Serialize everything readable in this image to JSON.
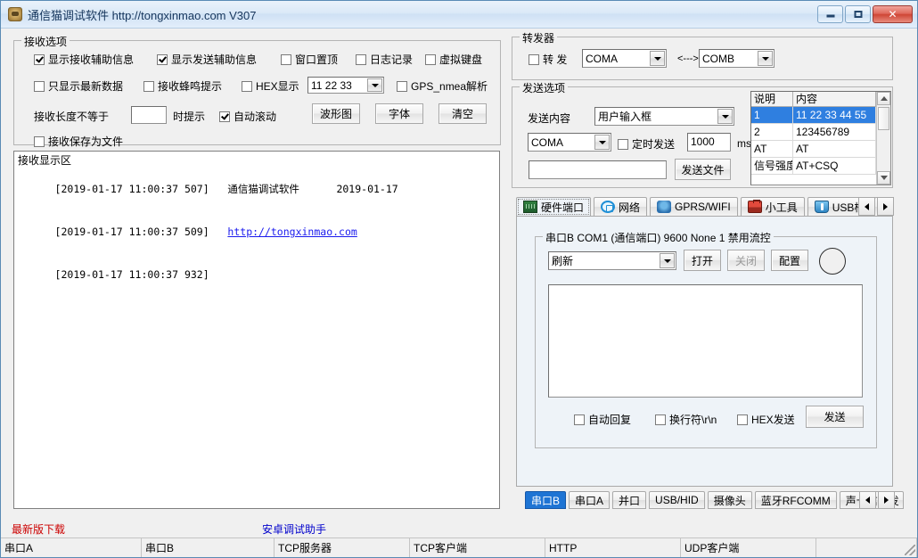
{
  "window": {
    "title": "通信猫调试软件  http://tongxinmao.com  V307",
    "icon": "app-cat-icon",
    "minimize_label": "−",
    "maximize_label": "□",
    "close_label": "✕"
  },
  "receive_options": {
    "legend": "接收选项",
    "row1": [
      {
        "label": "显示接收辅助信息",
        "checked": true
      },
      {
        "label": "显示发送辅助信息",
        "checked": true
      },
      {
        "label": "窗口置顶",
        "checked": false
      },
      {
        "label": "日志记录",
        "checked": false
      },
      {
        "label": "虚拟键盘",
        "checked": false
      }
    ],
    "row2": [
      {
        "label": "只显示最新数据",
        "checked": false
      },
      {
        "label": "接收蜂鸣提示",
        "checked": false
      },
      {
        "label": "HEX显示",
        "checked": false
      }
    ],
    "hex_combo_value": "11 22 33",
    "gps_checkbox": {
      "label": "GPS_nmea解析",
      "checked": false
    },
    "length_prefix": "接收长度不等于",
    "length_value": "",
    "length_suffix": "时提示",
    "autoscroll": {
      "label": "自动滚动",
      "checked": true
    },
    "buttons": [
      "波形图",
      "字体",
      "清空"
    ],
    "save_to_file": {
      "label": "接收保存为文件",
      "checked": false
    }
  },
  "receive_display": {
    "title": "接收显示区",
    "lines": [
      {
        "stamp": "[2019-01-17 11:00:37 507]",
        "text": "通信猫调试软件      2019-01-17",
        "link": false
      },
      {
        "stamp": "[2019-01-17 11:00:37 509]",
        "text": "http://tongxinmao.com",
        "link": true
      },
      {
        "stamp": "[2019-01-17 11:00:37 932]",
        "text": "",
        "link": false
      }
    ]
  },
  "repeater": {
    "legend": "转发器",
    "checkbox": {
      "label": "转 发",
      "checked": false
    },
    "source": "COMA",
    "arrow": "<--->",
    "target": "COMB"
  },
  "send_options": {
    "legend": "发送选项",
    "content_label": "发送内容",
    "content_value": "用户输入框",
    "port_value": "COMA",
    "timer_checkbox": {
      "label": "定时发送",
      "checked": false
    },
    "timer_value": "1000",
    "timer_unit": "ms",
    "file_path": "",
    "send_file_button": "发送文件"
  },
  "quick_list": {
    "columns": [
      "说明",
      "内容"
    ],
    "rows": [
      {
        "desc": "1",
        "content": "11 22 33 44 55",
        "selected": true
      },
      {
        "desc": "2",
        "content": "123456789",
        "selected": false
      },
      {
        "desc": "AT",
        "content": "AT",
        "selected": false
      },
      {
        "desc": "信号强度",
        "content": "AT+CSQ",
        "selected": false
      }
    ]
  },
  "main_tabs": {
    "items": [
      {
        "label": "硬件端口",
        "icon": "circuit-board-icon",
        "active": true
      },
      {
        "label": "网络",
        "icon": "network-icon",
        "active": false
      },
      {
        "label": "GPRS/WIFI",
        "icon": "wireless-icon",
        "active": false
      },
      {
        "label": "小工具",
        "icon": "toolbox-icon",
        "active": false
      },
      {
        "label": "USB桥",
        "icon": "usb-icon",
        "active": false
      },
      {
        "label": "",
        "icon": "bluetooth-icon",
        "active": false
      }
    ],
    "scroll_left": "◀",
    "scroll_right": "▶"
  },
  "serial_panel": {
    "legend": "串口B COM1 (通信端口) 9600  None  1 禁用流控",
    "port_combo": "刷新",
    "open_button": "打开",
    "close_button": "关闭",
    "config_button": "配置",
    "led": "status-led",
    "send_text": "",
    "auto_reply": {
      "label": "自动回复",
      "checked": false
    },
    "newline": {
      "label": "换行符\\r\\n",
      "checked": false
    },
    "hex_send": {
      "label": "HEX发送",
      "checked": false
    },
    "send_button": "发送"
  },
  "bottom_tabs": {
    "items": [
      {
        "label": "串口B",
        "active": true
      },
      {
        "label": "串口A",
        "active": false
      },
      {
        "label": "并口",
        "active": false
      },
      {
        "label": "USB/HID",
        "active": false
      },
      {
        "label": "摄像头",
        "active": false
      },
      {
        "label": "蓝牙RFCOMM",
        "active": false
      },
      {
        "label": "声卡信号发",
        "active": false
      }
    ],
    "scroll_left": "◀",
    "scroll_right": "▶"
  },
  "footer_links": {
    "download": "最新版下载",
    "android": "安卓调试助手",
    "download_color": "#cc0000",
    "android_color": "#0000cc"
  },
  "status_bar": {
    "cells": [
      "串口A",
      "串口B",
      "TCP服务器",
      "TCP客户端",
      "HTTP",
      "UDP客户端",
      ""
    ]
  },
  "colors": {
    "titlebar_text": "#15355c",
    "selection": "#2f7fe0",
    "link": "#1a1aee"
  }
}
